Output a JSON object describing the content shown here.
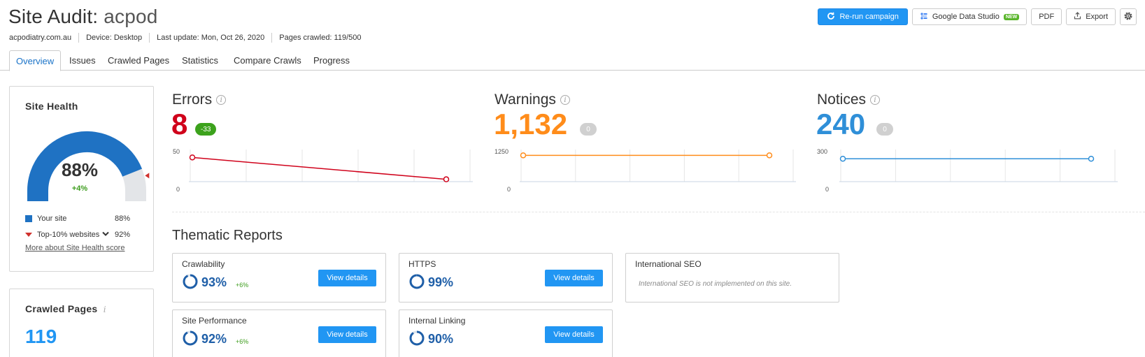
{
  "header": {
    "title_prefix": "Site Audit:",
    "project": "acpod",
    "domain": "acpodiatry.com.au",
    "device": "Device: Desktop",
    "last_update": "Last update: Mon, Oct 26, 2020",
    "pages_crawled": "Pages crawled: 119/500",
    "rerun_label": "Re-run campaign",
    "gds_label": "Google Data Studio",
    "gds_badge": "NEW",
    "pdf_label": "PDF",
    "export_label": "Export"
  },
  "tabs": [
    {
      "label": "Overview",
      "active": true
    },
    {
      "label": "Issues"
    },
    {
      "label": "Crawled Pages"
    },
    {
      "label": "Statistics"
    },
    {
      "label": "Compare Crawls"
    },
    {
      "label": "Progress"
    }
  ],
  "site_health": {
    "title": "Site Health",
    "percent": "88%",
    "delta": "+4%",
    "value_fraction": 0.88,
    "top10_fraction": 0.92,
    "legend": [
      {
        "label": "Your site",
        "value": "88%"
      },
      {
        "label": "Top-10% websites",
        "value": "92%"
      }
    ],
    "more_link": "More about Site Health score"
  },
  "crawled_pages": {
    "title": "Crawled Pages",
    "value": "119"
  },
  "metrics": {
    "errors": {
      "title": "Errors",
      "value": "8",
      "delta": "-33",
      "ymax": "50",
      "ymin": "0",
      "color": "#d0021b",
      "start": 42,
      "end": 8,
      "scale_max": 50
    },
    "warnings": {
      "title": "Warnings",
      "value": "1,132",
      "delta": "0",
      "ymax": "1250",
      "ymin": "0",
      "color": "#ff8c1a",
      "start": 1132,
      "end": 1132,
      "scale_max": 1250
    },
    "notices": {
      "title": "Notices",
      "value": "240",
      "delta": "0",
      "ymax": "300",
      "ymin": "0",
      "color": "#2f8fd8",
      "start": 240,
      "end": 240,
      "scale_max": 300
    }
  },
  "thematic": {
    "title": "Thematic Reports",
    "view_details": "View details",
    "reports": [
      {
        "name": "Crawlability",
        "percent": "93%",
        "delta": "+6%",
        "fraction": 0.93
      },
      {
        "name": "HTTPS",
        "percent": "99%",
        "fraction": 0.99
      },
      {
        "name": "International SEO",
        "note": "International SEO is not implemented on this site."
      },
      {
        "name": "Site Performance",
        "percent": "92%",
        "delta": "+6%",
        "fraction": 0.92
      },
      {
        "name": "Internal Linking",
        "percent": "90%",
        "fraction": 0.9
      }
    ]
  }
}
